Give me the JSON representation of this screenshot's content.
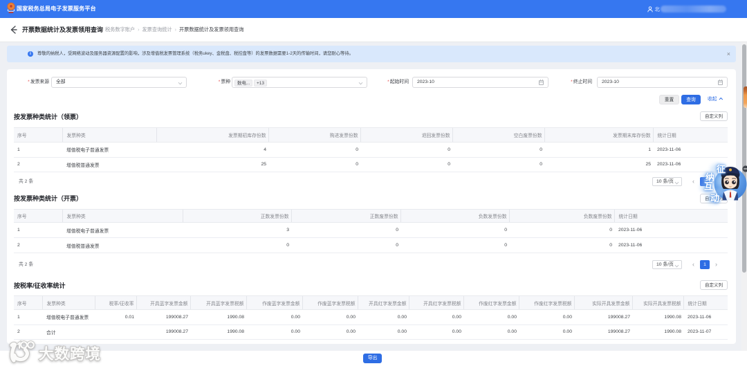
{
  "topbar": {
    "brand": "国家税务总局电子发票服务平台",
    "user_prefix": "北"
  },
  "titlebar": {
    "title": "开票数据统计及发票领用查询",
    "breadcrumb": [
      "税务数字账户",
      "发票查询统计",
      "开票数据统计及发票领用查询"
    ],
    "separator": "›"
  },
  "banner": {
    "icon": "i",
    "text": "尊敬的纳税人，受网络波动及服务器资源配置的影响，涉及增值税发票管理系统（税务ukey、金税盘、税控盘等）的发票数据需要1-2天的传输时间，请您耐心等待。",
    "close": "×"
  },
  "filters": {
    "invoice_source": {
      "label": "发票来源",
      "value": "全部"
    },
    "invoice_type": {
      "label": "票种",
      "tag1": "数电...",
      "tag2": "+13"
    },
    "start_time": {
      "label": "起始时间",
      "value": "2023-10"
    },
    "end_time": {
      "label": "终止时间",
      "value": "2023-10"
    }
  },
  "actions": {
    "reset": "重置",
    "query": "查询",
    "collapse": "收起"
  },
  "sections": [
    {
      "title": "按发票种类统计（领票）",
      "customize": "自定义列",
      "columns": [
        "序号",
        "发票种类",
        "发票期初库存份数",
        "购进发票份数",
        "退回发票份数",
        "空白废票份数",
        "发票期末库存份数",
        "统计日期"
      ],
      "rows": [
        [
          "1",
          "增值税电子普通发票",
          "4",
          "0",
          "0",
          "0",
          "1",
          "2023-11-06"
        ],
        [
          "2",
          "增值税普通发票",
          "25",
          "0",
          "0",
          "0",
          "25",
          "2023-11-06"
        ]
      ],
      "total_label": "共 2 条",
      "page_size_label": "10 条/页",
      "prev": "‹",
      "next": "›",
      "page": "1"
    },
    {
      "title": "按发票种类统计（开票）",
      "customize": "自定义列",
      "columns": [
        "序号",
        "发票种类",
        "正数发票份数",
        "正数废票份数",
        "负数发票份数",
        "负数废票份数",
        "统计日期"
      ],
      "rows": [
        [
          "1",
          "增值税电子普通发票",
          "3",
          "0",
          "0",
          "0",
          "2023-11-06"
        ],
        [
          "2",
          "增值税普通发票",
          "0",
          "0",
          "0",
          "0",
          "2023-11-06"
        ]
      ],
      "total_label": "共 2 条",
      "page_size_label": "10 条/页",
      "prev": "‹",
      "next": "›",
      "page": "1"
    },
    {
      "title": "按税率/征收率统计",
      "customize": "自定义列",
      "columns": [
        "序号",
        "发票种类",
        "税率/征收率",
        "开具蓝字发票金额",
        "开具蓝字发票税额",
        "作废蓝字发票金额",
        "作废蓝字发票税额",
        "开具红字发票金额",
        "开具红字发票税额",
        "作废红字发票金额",
        "作废红字发票税额",
        "实际开具发票金额",
        "实际开具发票税额",
        "统计日期"
      ],
      "rows": [
        [
          "1",
          "增值税电子普通发票",
          "0.01",
          "199008.27",
          "1990.08",
          "0.00",
          "0.00",
          "0.00",
          "0.00",
          "0.00",
          "0.00",
          "199008.27",
          "1990.08",
          "2023-11-06"
        ],
        [
          "2",
          "合计",
          "",
          "199008.27",
          "1990.08",
          "0.00",
          "0.00",
          "0.00",
          "0.00",
          "0.00",
          "0.00",
          "199008.27",
          "1990.08",
          "2023-11-07"
        ]
      ]
    }
  ],
  "footer": {
    "export": "导出"
  },
  "watermark": {
    "text": "大数跨境"
  },
  "assistant": {
    "chars": [
      "征",
      "纳",
      "互",
      "动"
    ]
  }
}
